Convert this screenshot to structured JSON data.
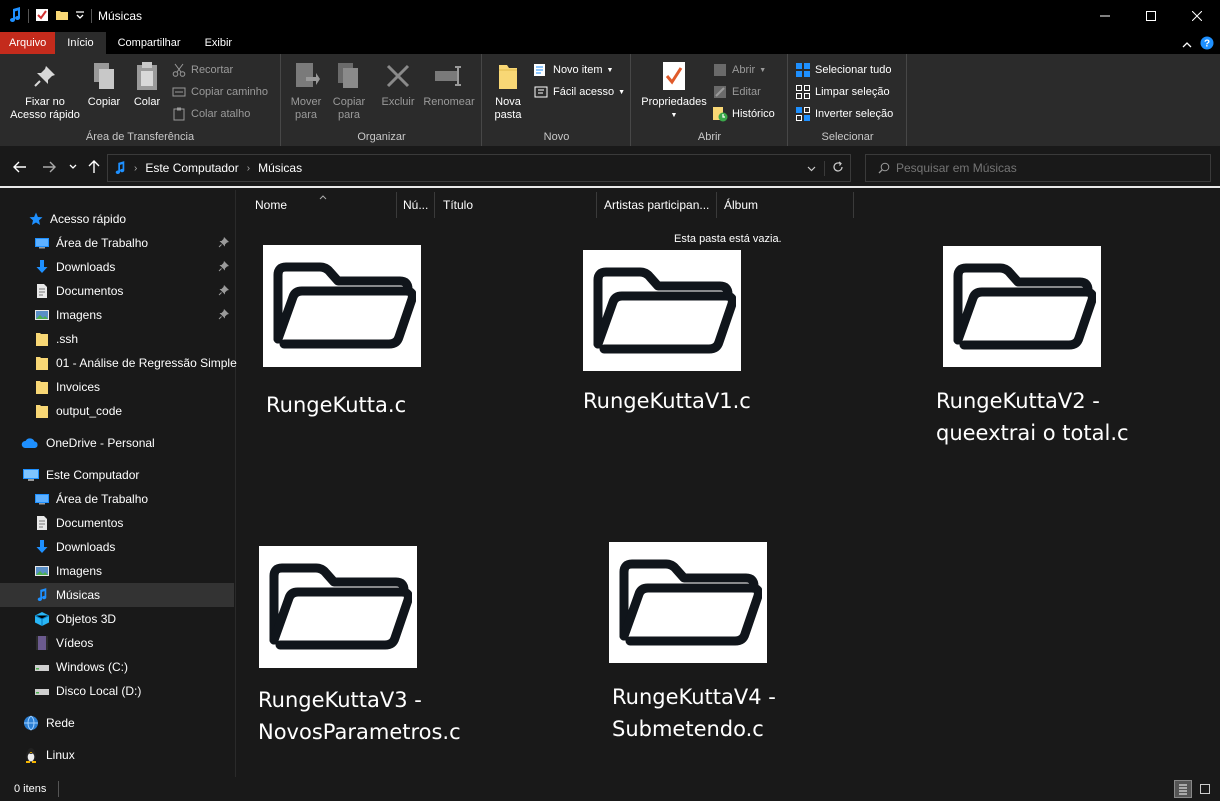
{
  "window": {
    "title": "Músicas"
  },
  "colors": {
    "file_tab": "#c42b1c",
    "accent": "#1e90ff",
    "folder_yellow": "#f8d775",
    "background": "#191919",
    "ribbon": "#2b2b2b"
  },
  "tabs": {
    "file": "Arquivo",
    "home": "Início",
    "share": "Compartilhar",
    "view": "Exibir"
  },
  "ribbon": {
    "clipboard": {
      "label": "Área de Transferência",
      "pin": "Fixar no Acesso rápido",
      "pin_line1": "Fixar no",
      "pin_line2": "Acesso rápido",
      "copy": "Copiar",
      "paste": "Colar",
      "cut": "Recortar",
      "copy_path": "Copiar caminho",
      "paste_shortcut": "Colar atalho"
    },
    "organize": {
      "label": "Organizar",
      "move_line1": "Mover",
      "move_line2": "para",
      "copy_line1": "Copiar",
      "copy_line2": "para",
      "delete": "Excluir",
      "rename": "Renomear"
    },
    "new": {
      "label": "Novo",
      "folder_line1": "Nova",
      "folder_line2": "pasta",
      "new_item": "Novo item",
      "easy_access": "Fácil acesso"
    },
    "open": {
      "label": "Abrir",
      "properties": "Propriedades",
      "open": "Abrir",
      "edit": "Editar",
      "history": "Histórico"
    },
    "select": {
      "label": "Selecionar",
      "select_all": "Selecionar tudo",
      "select_none": "Limpar seleção",
      "invert": "Inverter seleção"
    }
  },
  "address": {
    "crumbs": [
      "Este Computador",
      "Músicas"
    ],
    "search_placeholder": "Pesquisar em Músicas"
  },
  "sidebar": {
    "quick_access": "Acesso rápido",
    "quick_items": [
      {
        "label": "Área de Trabalho",
        "icon": "desktop-icon",
        "pinned": true
      },
      {
        "label": "Downloads",
        "icon": "download-icon",
        "pinned": true
      },
      {
        "label": "Documentos",
        "icon": "document-icon",
        "pinned": true
      },
      {
        "label": "Imagens",
        "icon": "pictures-icon",
        "pinned": true
      },
      {
        "label": ".ssh",
        "icon": "folder-icon",
        "pinned": false
      },
      {
        "label": "01 - Análise de Regressão Simples",
        "icon": "folder-icon",
        "pinned": false
      },
      {
        "label": "Invoices",
        "icon": "folder-icon",
        "pinned": false
      },
      {
        "label": "output_code",
        "icon": "folder-icon",
        "pinned": false
      }
    ],
    "onedrive": "OneDrive - Personal",
    "this_pc": "Este Computador",
    "pc_items": [
      {
        "label": "Área de Trabalho",
        "icon": "desktop-icon"
      },
      {
        "label": "Documentos",
        "icon": "document-icon"
      },
      {
        "label": "Downloads",
        "icon": "download-icon"
      },
      {
        "label": "Imagens",
        "icon": "pictures-icon"
      },
      {
        "label": "Músicas",
        "icon": "music-icon"
      },
      {
        "label": "Objetos 3D",
        "icon": "cube-icon"
      },
      {
        "label": "Vídeos",
        "icon": "video-icon"
      },
      {
        "label": "Windows (C:)",
        "icon": "drive-icon"
      },
      {
        "label": "Disco Local (D:)",
        "icon": "drive-icon"
      }
    ],
    "network": "Rede",
    "linux": "Linux"
  },
  "columns": [
    "Nome",
    "Nú...",
    "Título",
    "Artistas participan...",
    "Álbum"
  ],
  "empty_message": "Esta pasta está vazia.",
  "files": [
    {
      "line1": "RungeKutta.c",
      "line2": ""
    },
    {
      "line1": "RungeKuttaV1.c",
      "line2": ""
    },
    {
      "line1": "RungeKuttaV2 -",
      "line2": "queextrai o total.c"
    },
    {
      "line1": "RungeKuttaV3 -",
      "line2": "NovosParametros.c"
    },
    {
      "line1": "RungeKuttaV4 -",
      "line2": "Submetendo.c"
    }
  ],
  "status": {
    "items": "0 itens"
  }
}
